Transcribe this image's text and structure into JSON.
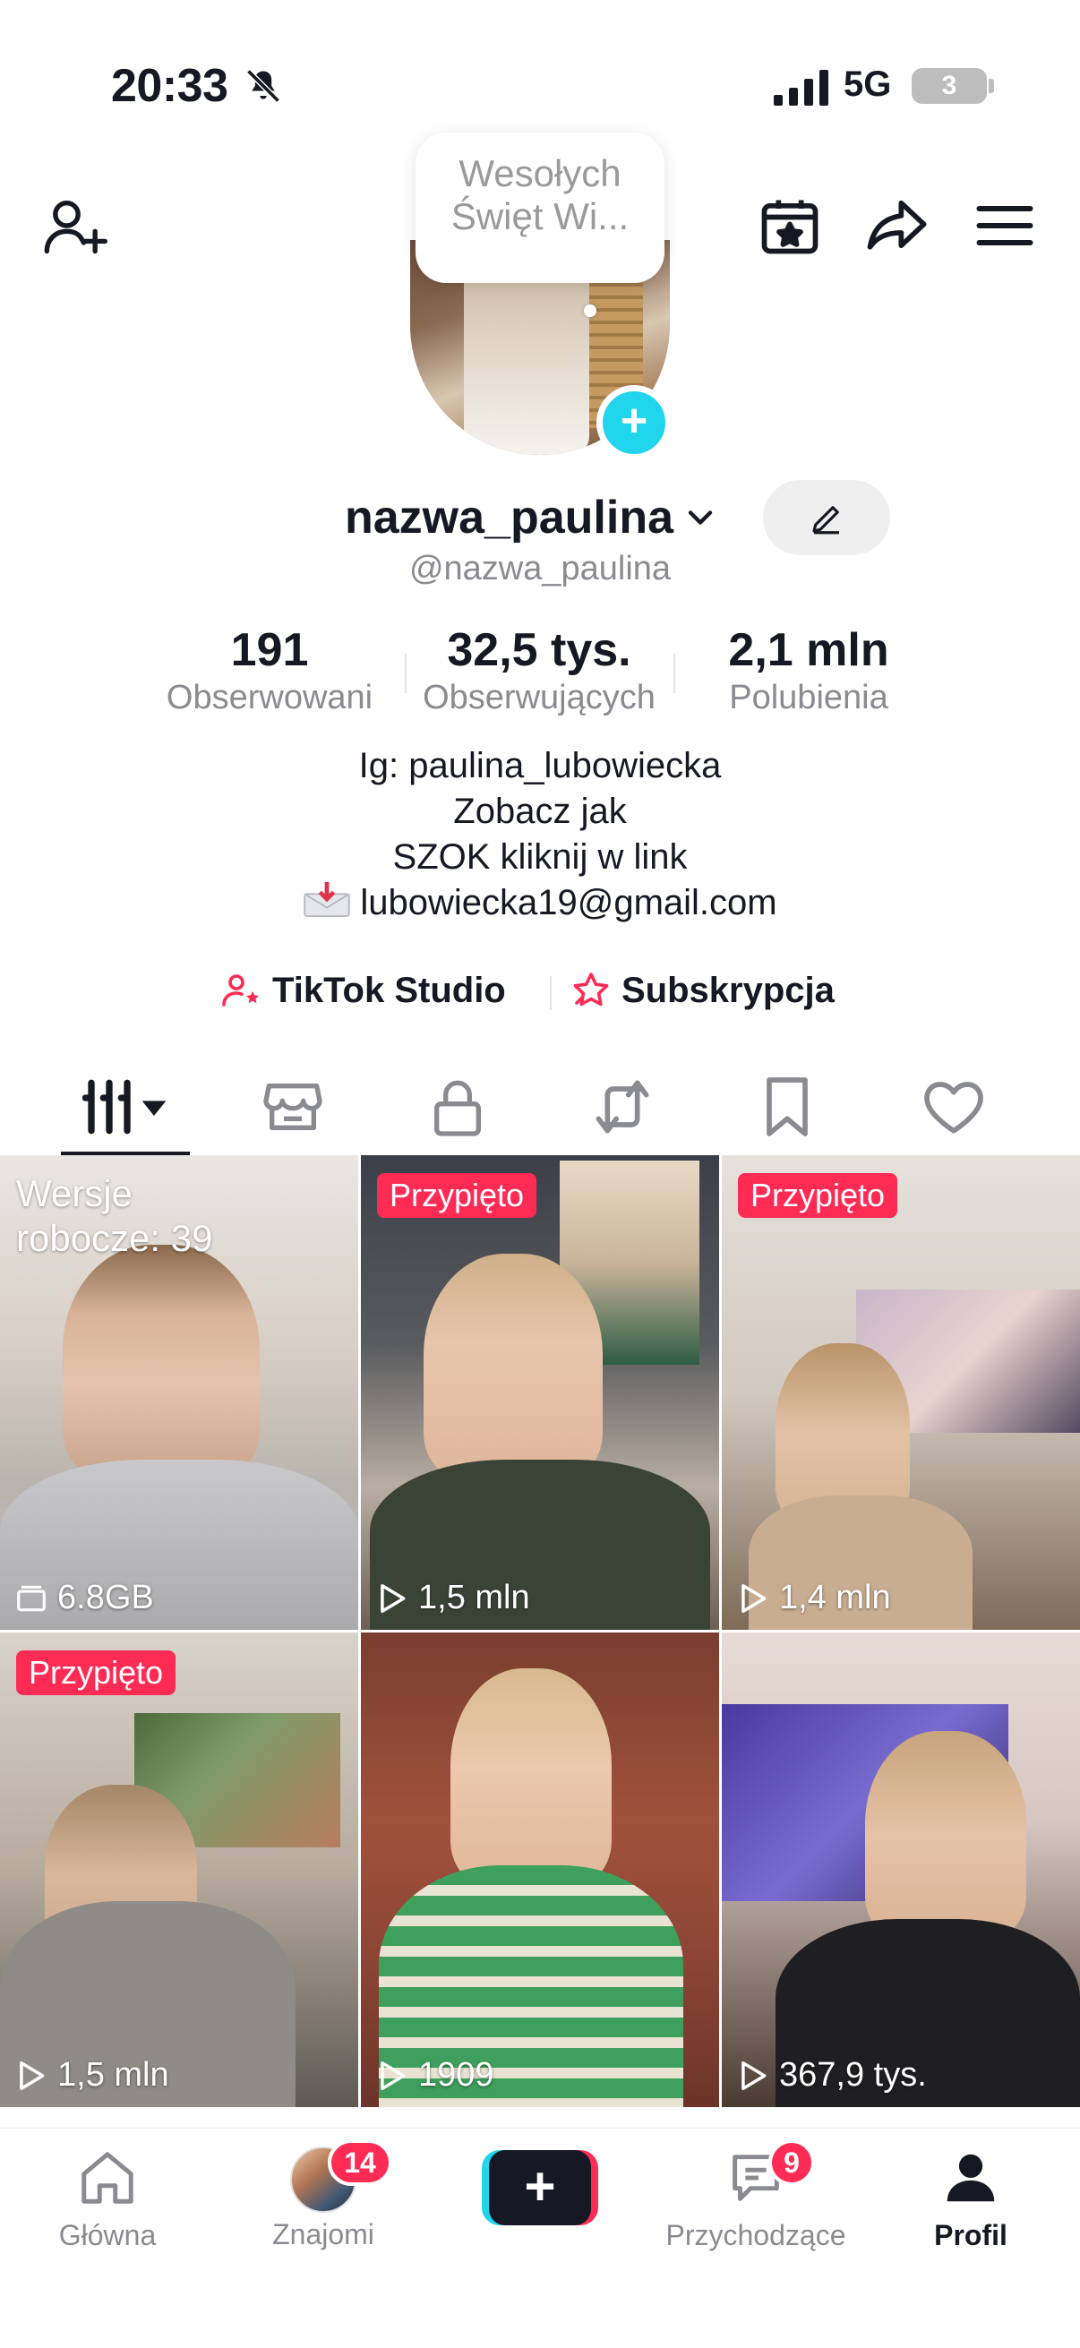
{
  "status_bar": {
    "time": "20:33",
    "network": "5G",
    "battery": "3"
  },
  "bubble": {
    "line1": "Wesołych",
    "line2": "Święt Wi..."
  },
  "profile": {
    "name": "nazwa_paulina",
    "handle": "@nazwa_paulina",
    "stats": [
      {
        "value": "191",
        "label": "Obserwowani"
      },
      {
        "value": "32,5 tys.",
        "label": "Obserwujących"
      },
      {
        "value": "2,1 mln",
        "label": "Polubienia"
      }
    ],
    "bio": [
      "Ig: paulina_lubowiecka",
      "Zobacz jak",
      "SZOK kliknij w link",
      "lubowiecka19@gmail.com"
    ]
  },
  "links": {
    "studio": "TikTok Studio",
    "subscription": "Subskrypcja"
  },
  "videos": [
    {
      "drafts_line1": "Wersje",
      "drafts_line2": "robocze: 39",
      "size": "6.8GB"
    },
    {
      "pinned": "Przypięto",
      "views": "1,5 mln"
    },
    {
      "pinned": "Przypięto",
      "views": "1,4 mln"
    },
    {
      "pinned": "Przypięto",
      "views": "1,5 mln"
    },
    {
      "views": "1909"
    },
    {
      "views": "367,9 tys."
    }
  ],
  "bottom_nav": {
    "home": "Główna",
    "friends": "Znajomi",
    "friends_badge": "14",
    "create": "+",
    "inbox": "Przychodzące",
    "inbox_badge": "9",
    "profile": "Profil"
  },
  "colors": {
    "accent_red": "#fe2c55",
    "accent_cyan": "#20d5ec",
    "text": "#161823",
    "muted": "#8a8b91"
  }
}
